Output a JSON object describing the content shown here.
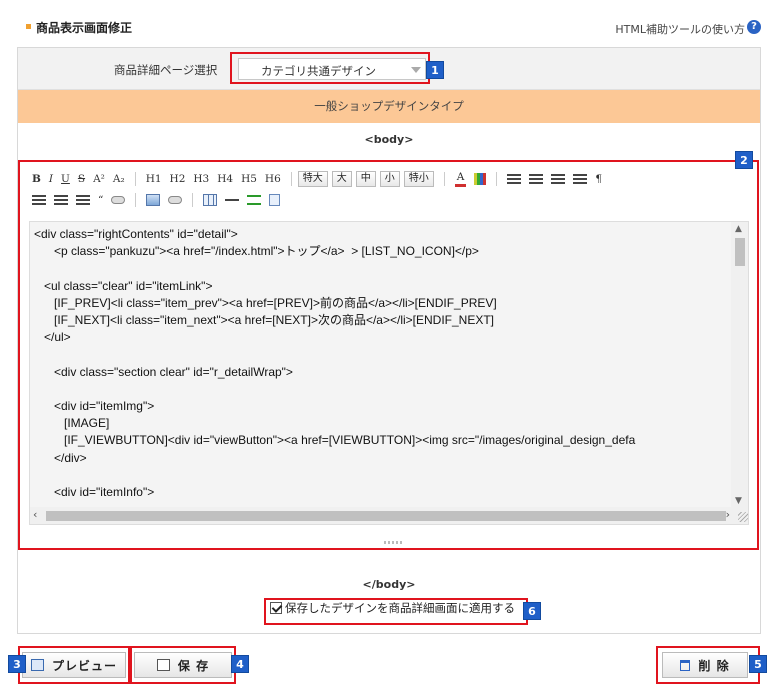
{
  "header": {
    "title": "商品表示画面修正",
    "help_link": "HTML補助ツールの使い方",
    "help_icon": "?"
  },
  "select_row": {
    "label": "商品詳細ページ選択",
    "selected": "カテゴリ共通デザイン"
  },
  "design_type": "一般ショップデザインタイプ",
  "tags": {
    "body_open": "<body>",
    "body_close": "</body>"
  },
  "toolbar": {
    "bold": "B",
    "italic": "I",
    "underline": "U",
    "strike": "S",
    "superscript": "A²",
    "subscript": "A₂",
    "h1": "H1",
    "h2": "H2",
    "h3": "H3",
    "h4": "H4",
    "h5": "H5",
    "h6": "H6",
    "size_xl": "特大",
    "size_l": "大",
    "size_m": "中",
    "size_s": "小",
    "size_xs": "特小",
    "font_color": "A",
    "paragraph": "¶"
  },
  "code_lines": [
    "<div class=\"rightContents\" id=\"detail\">",
    "      <p class=\"pankuzu\"><a href=\"/index.html\">トップ</a>  > [LIST_NO_ICON]</p>",
    "",
    "   <ul class=\"clear\" id=\"itemLink\">",
    "      [IF_PREV]<li class=\"item_prev\"><a href=[PREV]>前の商品</a></li>[ENDIF_PREV]",
    "      [IF_NEXT]<li class=\"item_next\"><a href=[NEXT]>次の商品</a></li>[ENDIF_NEXT]",
    "   </ul>",
    "",
    "      <div class=\"section clear\" id=\"r_detailWrap\">",
    "",
    "      <div id=\"itemImg\">",
    "         [IMAGE]",
    "         [IF_VIEWBUTTON]<div id=\"viewButton\"><a href=[VIEWBUTTON]><img src=\"/images/original_design_defa",
    "      </div>",
    "",
    "      <div id=\"itemInfo\">"
  ],
  "apply_checkbox": {
    "checked": true,
    "label": "保存したデザインを商品詳細画面に適用する"
  },
  "buttons": {
    "preview": "プレビュー",
    "save": "保 存",
    "delete": "削 除"
  },
  "badges": [
    "1",
    "2",
    "3",
    "4",
    "5",
    "6"
  ],
  "colors": {
    "highlight": "#e0141e",
    "badge": "#1f5fc8",
    "design_type_bg": "#fcc896"
  }
}
